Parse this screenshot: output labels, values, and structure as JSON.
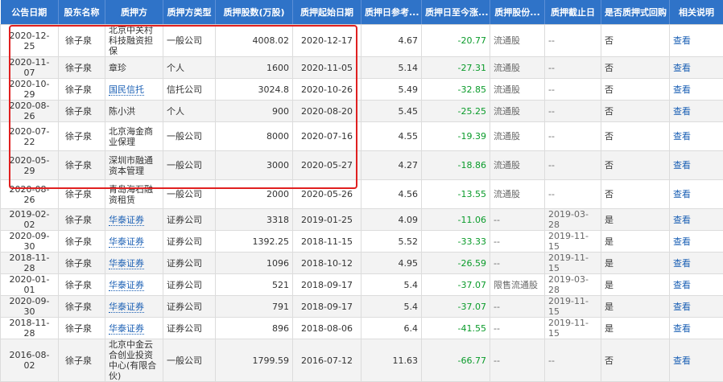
{
  "table": {
    "headers": [
      "公告日期",
      "股东名称",
      "质押方",
      "质押方类型",
      "质押股数(万股)",
      "质押起始日期",
      "质押日参考...",
      "质押日至今涨...",
      "质押股份...",
      "质押截止日",
      "是否质押式回购",
      "相关说明"
    ],
    "rows": [
      {
        "ann_date": "2020-12-25",
        "holder": "徐子泉",
        "pledgee": "北京中关村科技融资担保",
        "pledgee_link": false,
        "type": "一般公司",
        "shares": "4008.02",
        "start": "2020-12-17",
        "ref_price": "4.67",
        "change": "-20.77",
        "share_type": "流通股",
        "end": "--",
        "repo": "否",
        "action": "查看"
      },
      {
        "ann_date": "2020-11-07",
        "holder": "徐子泉",
        "pledgee": "章珍",
        "pledgee_link": false,
        "type": "个人",
        "shares": "1600",
        "start": "2020-11-05",
        "ref_price": "5.14",
        "change": "-27.31",
        "share_type": "流通股",
        "end": "--",
        "repo": "否",
        "action": "查看"
      },
      {
        "ann_date": "2020-10-29",
        "holder": "徐子泉",
        "pledgee": "国民信托",
        "pledgee_link": true,
        "type": "信托公司",
        "shares": "3024.8",
        "start": "2020-10-26",
        "ref_price": "5.49",
        "change": "-32.85",
        "share_type": "流通股",
        "end": "--",
        "repo": "否",
        "action": "查看"
      },
      {
        "ann_date": "2020-08-26",
        "holder": "徐子泉",
        "pledgee": "陈小洪",
        "pledgee_link": false,
        "type": "个人",
        "shares": "900",
        "start": "2020-08-20",
        "ref_price": "5.45",
        "change": "-25.25",
        "share_type": "流通股",
        "end": "--",
        "repo": "否",
        "action": "查看"
      },
      {
        "ann_date": "2020-07-22",
        "holder": "徐子泉",
        "pledgee": "北京海金商业保理",
        "pledgee_link": false,
        "type": "一般公司",
        "shares": "8000",
        "start": "2020-07-16",
        "ref_price": "4.55",
        "change": "-19.39",
        "share_type": "流通股",
        "end": "--",
        "repo": "否",
        "action": "查看"
      },
      {
        "ann_date": "2020-05-29",
        "holder": "徐子泉",
        "pledgee": "深圳市融通资本管理",
        "pledgee_link": false,
        "type": "一般公司",
        "shares": "3000",
        "start": "2020-05-27",
        "ref_price": "4.27",
        "change": "-18.86",
        "share_type": "流通股",
        "end": "--",
        "repo": "否",
        "action": "查看"
      },
      {
        "ann_date": "2020-08-26",
        "holder": "徐子泉",
        "pledgee": "青岛海石融资租赁",
        "pledgee_link": false,
        "type": "一般公司",
        "shares": "2000",
        "start": "2020-05-26",
        "ref_price": "4.56",
        "change": "-13.55",
        "share_type": "流通股",
        "end": "--",
        "repo": "否",
        "action": "查看"
      },
      {
        "ann_date": "2019-02-02",
        "holder": "徐子泉",
        "pledgee": "华泰证券",
        "pledgee_link": true,
        "type": "证券公司",
        "shares": "3318",
        "start": "2019-01-25",
        "ref_price": "4.09",
        "change": "-11.06",
        "share_type": "--",
        "end": "2019-03-28",
        "repo": "是",
        "action": "查看"
      },
      {
        "ann_date": "2020-09-30",
        "holder": "徐子泉",
        "pledgee": "华泰证券",
        "pledgee_link": true,
        "type": "证券公司",
        "shares": "1392.25",
        "start": "2018-11-15",
        "ref_price": "5.52",
        "change": "-33.33",
        "share_type": "--",
        "end": "2019-11-15",
        "repo": "是",
        "action": "查看"
      },
      {
        "ann_date": "2018-11-28",
        "holder": "徐子泉",
        "pledgee": "华泰证券",
        "pledgee_link": true,
        "type": "证券公司",
        "shares": "1096",
        "start": "2018-10-12",
        "ref_price": "4.95",
        "change": "-26.59",
        "share_type": "--",
        "end": "2019-11-15",
        "repo": "是",
        "action": "查看"
      },
      {
        "ann_date": "2020-01-01",
        "holder": "徐子泉",
        "pledgee": "华泰证券",
        "pledgee_link": true,
        "type": "证券公司",
        "shares": "521",
        "start": "2018-09-17",
        "ref_price": "5.4",
        "change": "-37.07",
        "share_type": "限售流通股",
        "end": "2019-03-28",
        "repo": "是",
        "action": "查看"
      },
      {
        "ann_date": "2020-09-30",
        "holder": "徐子泉",
        "pledgee": "华泰证券",
        "pledgee_link": true,
        "type": "证券公司",
        "shares": "791",
        "start": "2018-09-17",
        "ref_price": "5.4",
        "change": "-37.07",
        "share_type": "--",
        "end": "2019-11-15",
        "repo": "是",
        "action": "查看"
      },
      {
        "ann_date": "2018-11-28",
        "holder": "徐子泉",
        "pledgee": "华泰证券",
        "pledgee_link": true,
        "type": "证券公司",
        "shares": "896",
        "start": "2018-08-06",
        "ref_price": "6.4",
        "change": "-41.55",
        "share_type": "--",
        "end": "2019-11-15",
        "repo": "是",
        "action": "查看"
      },
      {
        "ann_date": "2016-08-02",
        "holder": "徐子泉",
        "pledgee": "北京中金云合创业投资中心(有限合伙)",
        "pledgee_link": false,
        "type": "一般公司",
        "shares": "1799.59",
        "start": "2016-07-12",
        "ref_price": "11.63",
        "change": "-66.77",
        "share_type": "--",
        "end": "--",
        "repo": "否",
        "action": "查看"
      }
    ]
  },
  "colors": {
    "header_bg": "#2f73c8",
    "negative": "#0a9b2a",
    "link": "#1a5fb4",
    "highlight": "#e02020"
  }
}
